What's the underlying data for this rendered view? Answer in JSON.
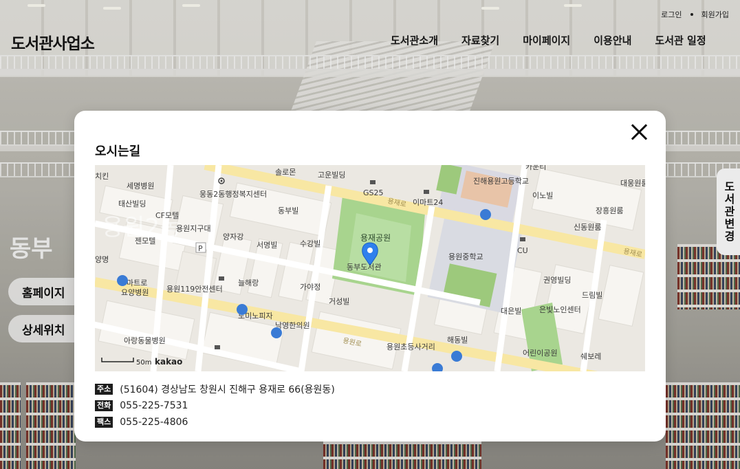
{
  "header": {
    "logo": "도서관사업소",
    "nav": [
      "도서관소개",
      "자료찾기",
      "마이페이지",
      "이용안내",
      "도서관 일정"
    ],
    "top_links": [
      "로그인",
      "회원가입"
    ]
  },
  "background_page": {
    "title_partial": "동부",
    "buttons": [
      "홈페이지 ",
      "상세위치 "
    ],
    "side_tab": "도서관변경"
  },
  "modal": {
    "title": "오시는길",
    "close_icon": "close-icon",
    "map": {
      "provider": "kakao",
      "scale_label": "50m",
      "marker_label": "동부도서관",
      "park_label": "용재공원",
      "road_labels": [
        "용재로",
        "용재로",
        "용원로"
      ],
      "district_watermark": "용원2동",
      "places": [
        "솔로몬",
        "고운빌딩",
        "GS25",
        "이마트24",
        "진해용원고등학교",
        "카운티",
        "대웅원룸",
        "세명병원",
        "웅동2동행정복지센터",
        "태산빌딩",
        "CF모텔",
        "용원지구대",
        "젠모텔",
        "동부빌",
        "양자강",
        "서명빌",
        "수강빌",
        "이노빌",
        "장흥원룸",
        "신동원룸",
        "CU",
        "용원중학교",
        "권영빌딩",
        "드림빌",
        "대은빌",
        "은빛노인센터",
        "늘해랑",
        "가야정",
        "거성빌",
        "용원119안전센터",
        "요양병원",
        "도미노피자",
        "낙영한의원",
        "아랑동물병원",
        "해동빌",
        "용원초등사거리",
        "어린이공원",
        "쉐보레",
        "마트로",
        "양명",
        "치킨"
      ]
    },
    "info": [
      {
        "label": "주소",
        "value": "(51604) 경상남도 창원시 진해구 용재로 66(용원동)"
      },
      {
        "label": "전화",
        "value": "055-225-7531"
      },
      {
        "label": "팩스",
        "value": "055-225-4806"
      }
    ]
  }
}
